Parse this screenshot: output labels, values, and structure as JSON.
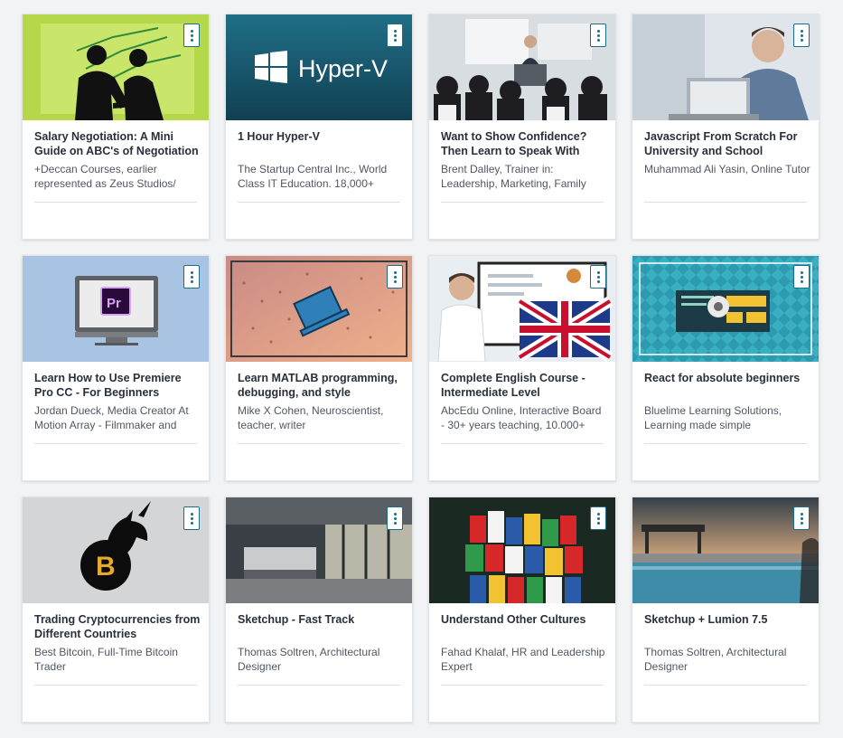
{
  "courses": [
    {
      "title": "Salary Negotiation: A Mini Guide on ABC's of Negotiation",
      "author": "+Deccan Courses, earlier represented as Zeus Studios/",
      "thumbnail": "handshake-silhouette-thumbnail"
    },
    {
      "title": "1 Hour Hyper-V",
      "author": "The Startup Central Inc., World Class IT Education. 18,000+",
      "thumbnail": "hyper-v-logo-thumbnail",
      "logo_text": "Hyper-V"
    },
    {
      "title": "Want to Show Confidence? Then Learn to Speak With",
      "author": "Brent Dalley, Trainer in: Leadership, Marketing, Family",
      "thumbnail": "speaker-audience-thumbnail"
    },
    {
      "title": "Javascript From Scratch For University and School",
      "author": "Muhammad Ali Yasin, Online Tutor",
      "thumbnail": "man-laptop-thumbnail"
    },
    {
      "title": "Learn How to Use Premiere Pro CC - For Beginners",
      "author": "Jordan Dueck, Media Creator At Motion Array - Filmmaker and",
      "thumbnail": "premiere-monitor-thumbnail",
      "logo_text": "Pr"
    },
    {
      "title": "Learn MATLAB programming, debugging, and style",
      "author": "Mike X Cohen, Neuroscientist, teacher, writer",
      "thumbnail": "laptop-particles-thumbnail"
    },
    {
      "title": "Complete English Course - Intermediate Level",
      "author": "AbcEdu Online, Interactive Board - 30+ years teaching, 10.000+",
      "thumbnail": "teacher-uk-flag-thumbnail"
    },
    {
      "title": "React for absolute beginners",
      "author": "Bluelime Learning Solutions, Learning made simple",
      "thumbnail": "react-pattern-thumbnail"
    },
    {
      "title": "Trading Cryptocurrencies from Different Countries",
      "author": "Best Bitcoin, Full-Time Bitcoin Trader",
      "thumbnail": "bitcoin-unicorn-thumbnail",
      "logo_text": "B"
    },
    {
      "title": "Sketchup - Fast Track",
      "author": "Thomas Soltren, Architectural Designer",
      "thumbnail": "interior-render-thumbnail"
    },
    {
      "title": "Understand Other Cultures",
      "author": "Fahad Khalaf, HR and Leadership Expert",
      "thumbnail": "flags-crowd-thumbnail"
    },
    {
      "title": "Sketchup + Lumion 7.5",
      "author": "Thomas Soltren, Architectural Designer",
      "thumbnail": "pool-render-thumbnail"
    }
  ],
  "colors": {
    "menu_accent": "#1b6e8a",
    "title_text": "#29303b",
    "author_text": "#505763",
    "page_bg": "#f2f3f5"
  }
}
